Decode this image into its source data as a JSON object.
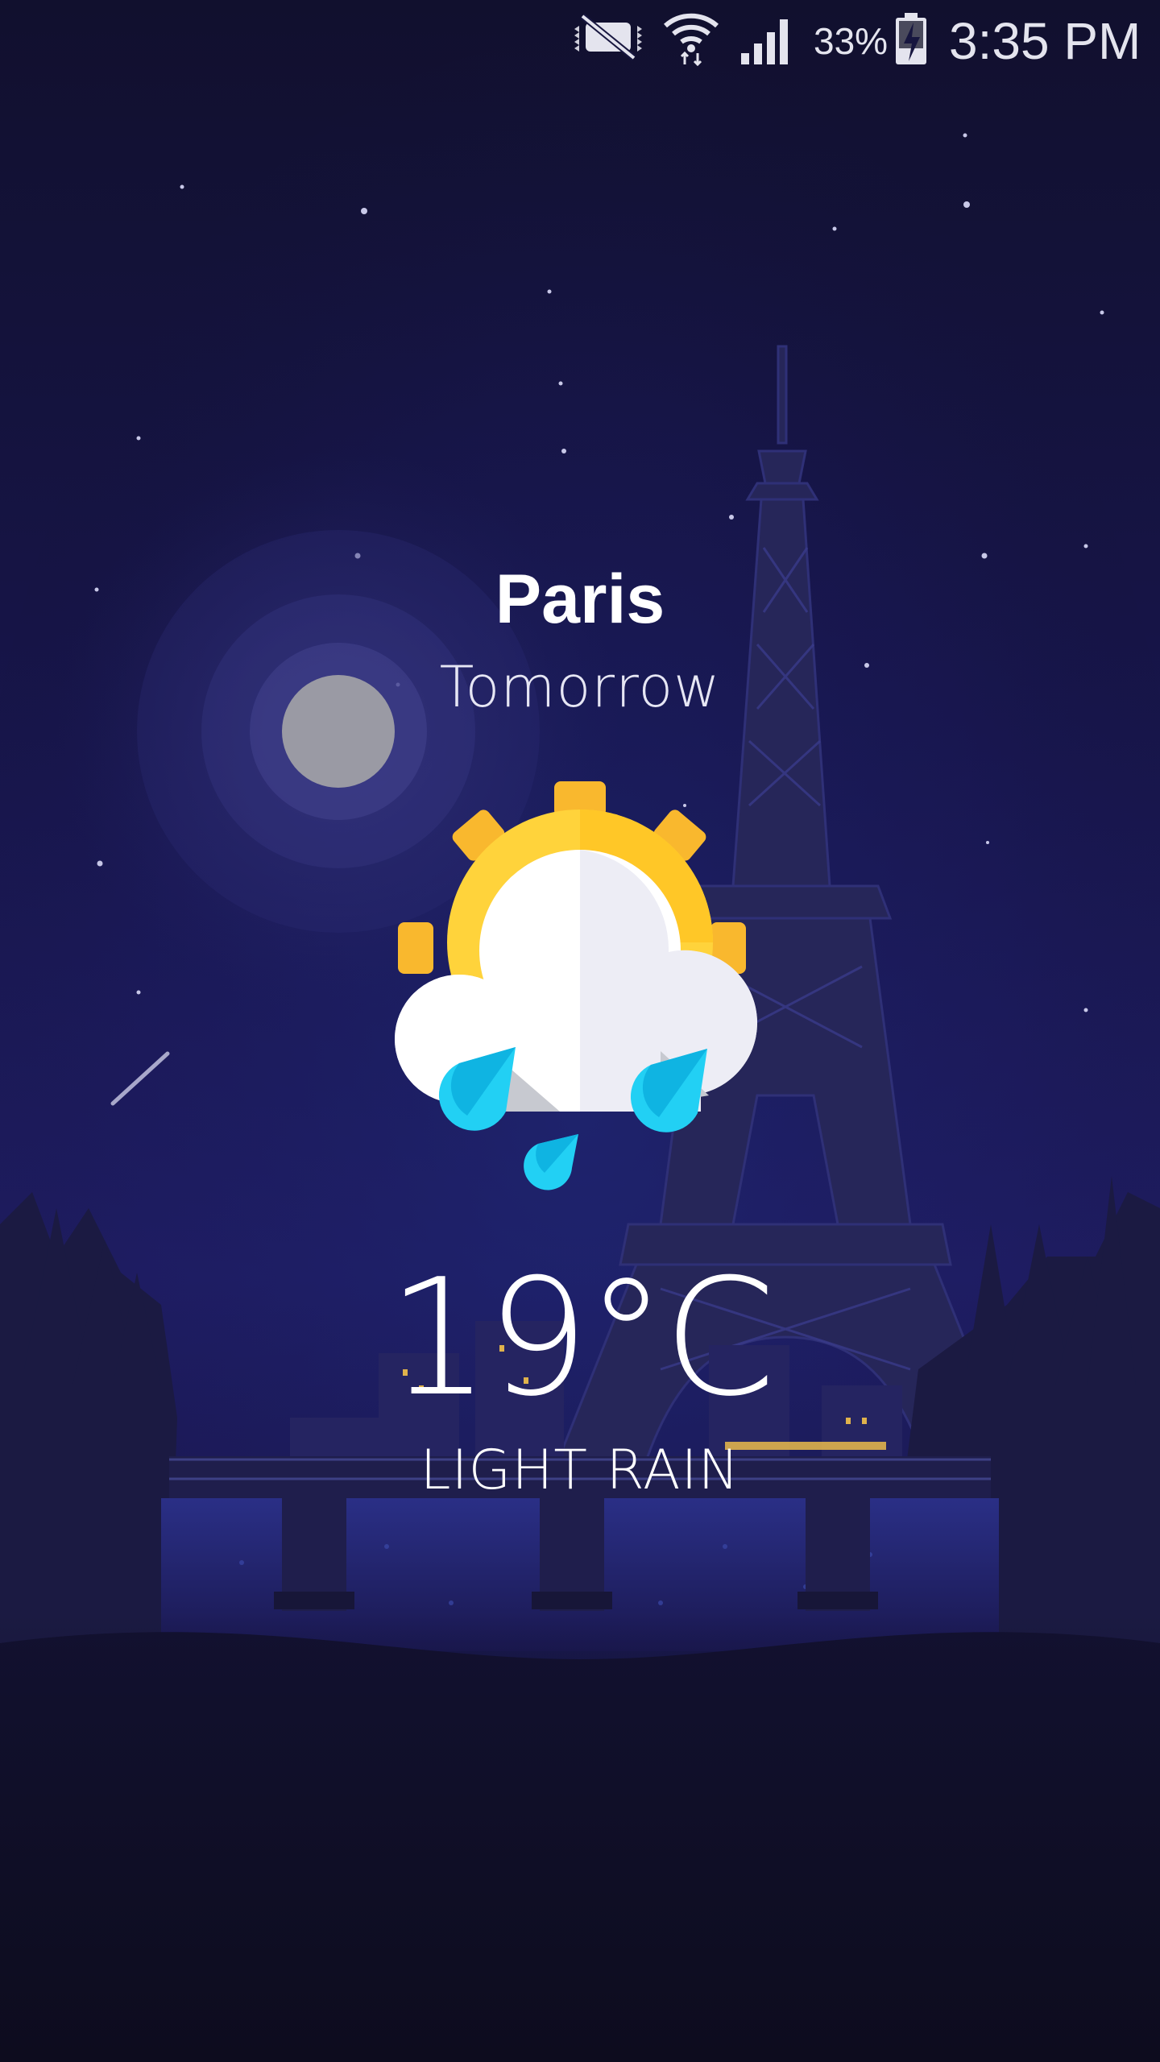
{
  "status_bar": {
    "icons": [
      "mute-icon",
      "wifi-icon",
      "signal-icon",
      "battery-charging-icon"
    ],
    "battery_percent": "33%",
    "time": "3:35 PM"
  },
  "weather": {
    "city": "Paris",
    "day": "Tomorrow",
    "temperature": "19°C",
    "condition": "LIGHT RAIN",
    "icon": "sun-cloud-rain-icon"
  },
  "colors": {
    "sky_top": "#13123a",
    "sky_mid": "#1d1a5c",
    "ground": "#0d0c1e",
    "sun": "#ffd33b",
    "rain": "#22d0f4",
    "window_light": "#f4c24a"
  }
}
